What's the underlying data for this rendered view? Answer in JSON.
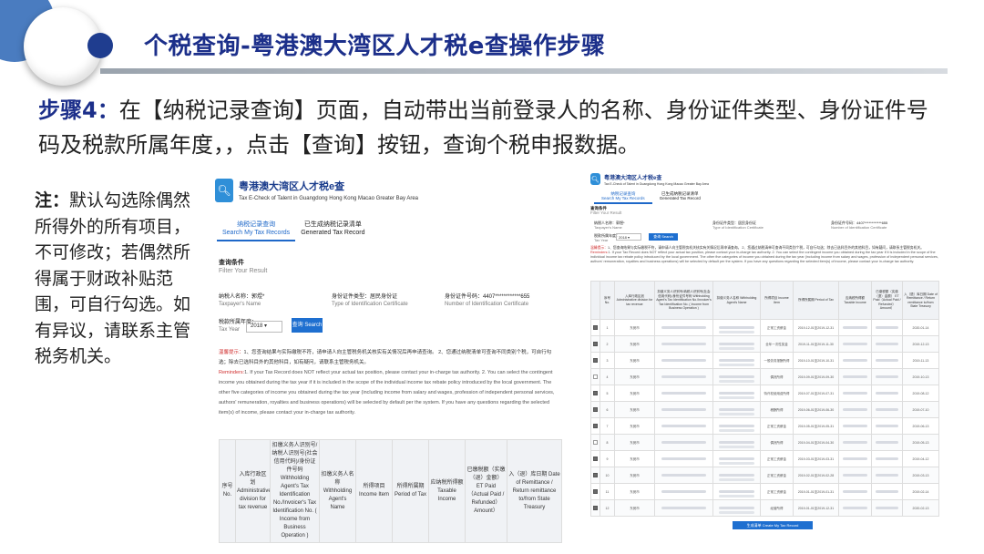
{
  "header": {
    "title": "个税查询-粤港澳大湾区人才税e查操作步骤"
  },
  "step": {
    "label": "步骤4：",
    "text": "在【纳税记录查询】页面，自动带出当前登录人的名称、身份证件类型、身份证件号码及税款所属年度，，点击【查询】按钮，查询个税申报数据。"
  },
  "note": {
    "label": "注：",
    "text": "默认勾选除偶然所得外的所有项目，不可修改；若偶然所得属于财政补贴范围，可自行勾选。如有异议，请联系主管税务机关。"
  },
  "app": {
    "logo_icon": "search-icon",
    "name_cn": "粤港澳大湾区人才税e查",
    "name_en": "Tax E-Check of Talent in Guangdong Hong Kong Macao Greater Bay Area",
    "tabs": [
      {
        "cn": "纳税记录查询",
        "en": "Search My Tax Records"
      },
      {
        "cn": "已生成纳税记录清单",
        "en": "Generated Tax Record"
      }
    ],
    "filter_title": "查询条件",
    "filter_sub": "Filter Your Result",
    "taxpayer_label": "纳税人名称：郭煜*",
    "taxpayer_en": "Taxpayer's Name",
    "id_type_label": "身份证件类型：居民身份证",
    "id_type_en": "Type of Identification Certificate",
    "id_num_label": "身份证件号码：4407************655",
    "id_num_en": "Number of Identification Certificate",
    "tax_year_label": "税款所属年度：",
    "tax_year_en": "Tax Year",
    "tax_year_value": "2018",
    "search_button": "查询 Search",
    "remind_label": "温馨提示：",
    "remind_cn": "1、您查询结果与实际缴税不符，请申请人向主管税务机关核实有关情况后再申请查询。 2、您通过纳税清单可查询不同类别个税，可自行勾选；除去已选科目外的其他科目，如有疑问，请联系主管税务机关。",
    "remind_en_label": "Reminders:",
    "remind_en": "1. If your Tax Record does NOT reflect your actual tax position, please contact your in-charge tax authority. 2. You can select the contingent income you obtained during the tax year if it is included in the scope of the individual income tax rebate policy introduced by the local government. The other five categories of income you obtained during the tax year (including income from salary and wages, profession of independent personal services, authors' remuneration, royalties and business operations) will be selected by default per the system. If you have any questions regarding the selected item(s) of income, please contact your in-charge tax authority.",
    "create_button": "生成清单 Create My Tax Record"
  },
  "table": {
    "headers": [
      "序号 No.",
      "入库行政区划 Administrative division for tax revenue",
      "扣缴义务人识别号/纳税人识别号(社会信用代码)/身份证件号码 Withholding Agent's Tax Identification No./Invoicer's Tax Identification No. ( Income from Business Operation )",
      "扣缴义务人名称 Withholding Agent's Name",
      "所得项目 Income Item",
      "所得所属期 Period of Tax",
      "应纳税所得额 Taxable Income",
      "已缴税额（实缴（退）金额） ET Paid（Actual Paid / Refunded） Amount）",
      "入（退）库日期 Date of Remittance / Return remittance to/from State Treasury"
    ],
    "rows": [
      {
        "no": "1",
        "region": "东莞市",
        "item": "正常工资薪金",
        "period": "2019-12-01至2019-12-31",
        "date": "2020-01-14",
        "checked": true
      },
      {
        "no": "2",
        "region": "东莞市",
        "item": "全年一次性奖金",
        "period": "2019-11-01至2019-11-30",
        "date": "2019-12-13",
        "checked": true
      },
      {
        "no": "3",
        "region": "东莞市",
        "item": "一般劳务报酬所得",
        "period": "2019-10-01至2019-10-31",
        "date": "2019-11-13",
        "checked": true
      },
      {
        "no": "4",
        "region": "东莞市",
        "item": "偶然所得",
        "period": "2019-09-01至2019-09-30",
        "date": "2019-10-13",
        "checked": false
      },
      {
        "no": "5",
        "region": "东莞市",
        "item": "特许权使用费所得",
        "period": "2019-07-01至2019-07-31",
        "date": "2019-08-12",
        "checked": true
      },
      {
        "no": "6",
        "region": "东莞市",
        "item": "稿酬所得",
        "period": "2019-06-01至2019-06-30",
        "date": "2019-07-10",
        "checked": true
      },
      {
        "no": "7",
        "region": "东莞市",
        "item": "正常工资薪金",
        "period": "2019-05-01至2019-05-31",
        "date": "2019-06-13",
        "checked": true
      },
      {
        "no": "8",
        "region": "东莞市",
        "item": "偶然所得",
        "period": "2019-04-01至2019-04-30",
        "date": "2019-05-13",
        "checked": false
      },
      {
        "no": "9",
        "region": "东莞市",
        "item": "正常工资薪金",
        "period": "2019-03-01至2019-03-31",
        "date": "2019-04-12",
        "checked": true
      },
      {
        "no": "10",
        "region": "东莞市",
        "item": "正常工资薪金",
        "period": "2019-02-01至2019-02-28",
        "date": "2019-03-13",
        "checked": true
      },
      {
        "no": "11",
        "region": "东莞市",
        "item": "正常工资薪金",
        "period": "2019-01-01至2019-01-31",
        "date": "2019-02-14",
        "checked": true
      },
      {
        "no": "12",
        "region": "东莞市",
        "item": "经营所得",
        "period": "2019-01-01至2019-12-31",
        "date": "2020-02-13",
        "checked": true
      }
    ]
  }
}
